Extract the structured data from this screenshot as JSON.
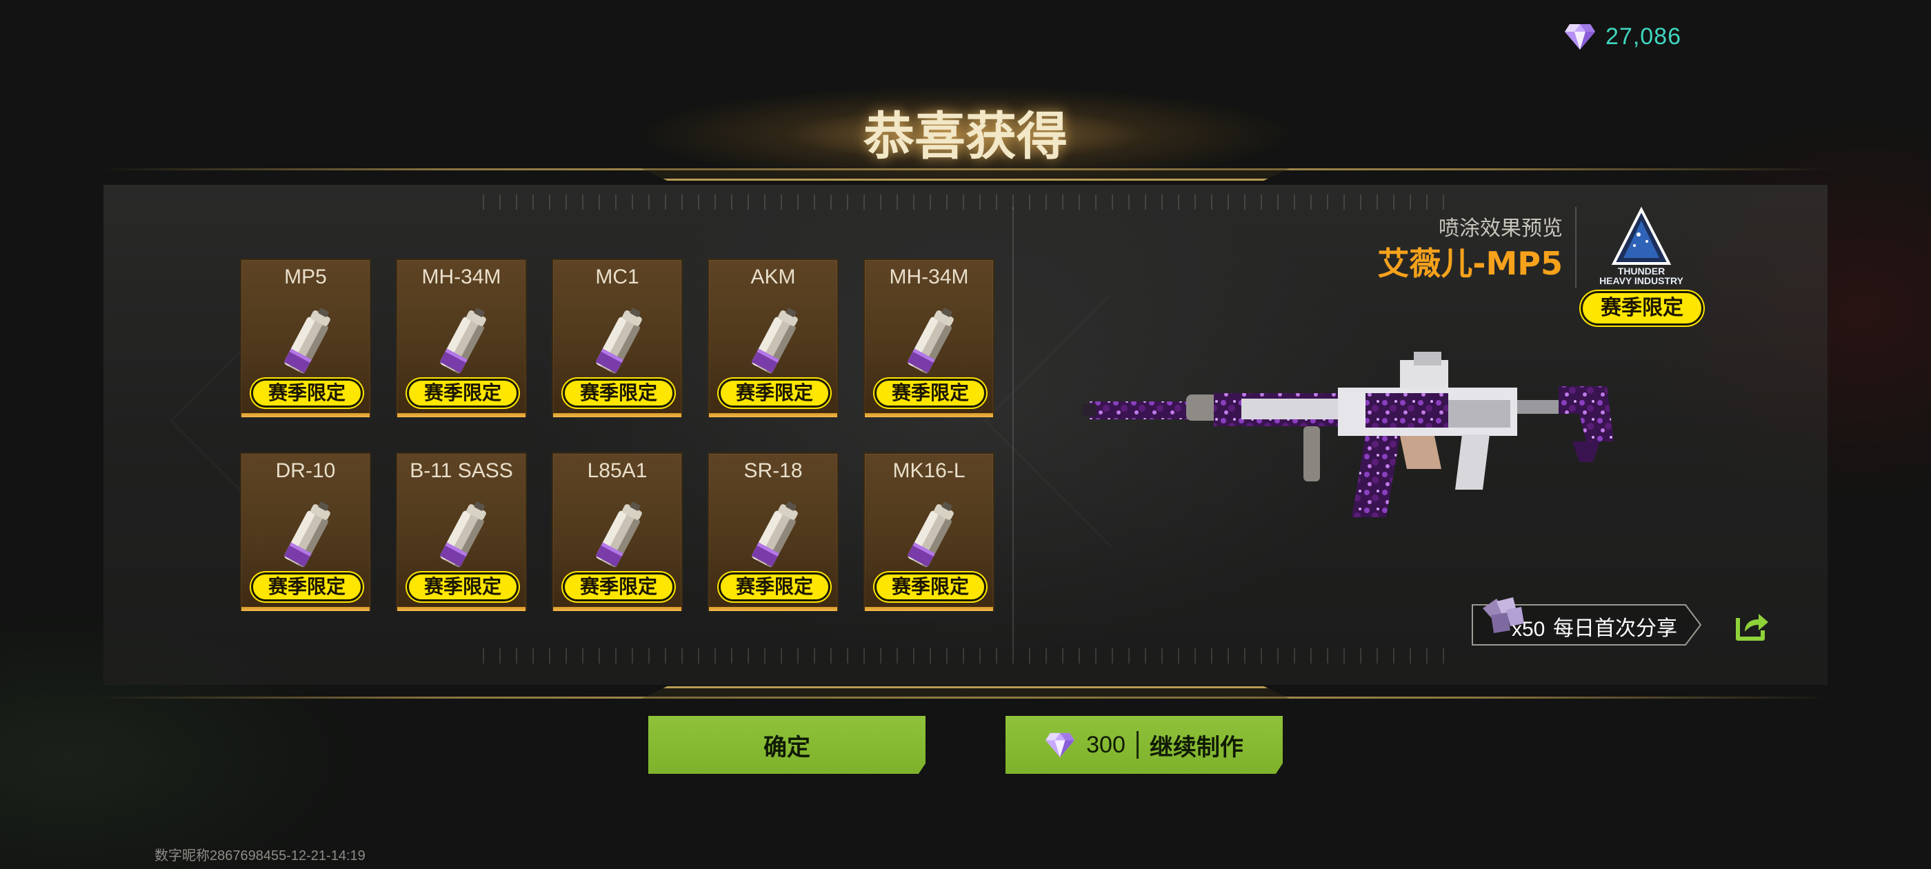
{
  "currency": {
    "icon": "diamond-icon",
    "amount": "27,086"
  },
  "title": "恭喜获得",
  "items": [
    {
      "name": "MP5",
      "badge": "赛季限定",
      "icon": "spray-can-icon"
    },
    {
      "name": "MH-34M",
      "badge": "赛季限定",
      "icon": "spray-can-icon"
    },
    {
      "name": "MC1",
      "badge": "赛季限定",
      "icon": "spray-can-icon"
    },
    {
      "name": "AKM",
      "badge": "赛季限定",
      "icon": "spray-can-icon"
    },
    {
      "name": "MH-34M",
      "badge": "赛季限定",
      "icon": "spray-can-icon"
    },
    {
      "name": "DR-10",
      "badge": "赛季限定",
      "icon": "spray-can-icon"
    },
    {
      "name": "B-11 SASS",
      "badge": "赛季限定",
      "icon": "spray-can-icon"
    },
    {
      "name": "L85A1",
      "badge": "赛季限定",
      "icon": "spray-can-icon"
    },
    {
      "name": "SR-18",
      "badge": "赛季限定",
      "icon": "spray-can-icon"
    },
    {
      "name": "MK16-L",
      "badge": "赛季限定",
      "icon": "spray-can-icon"
    }
  ],
  "preview": {
    "label": "喷涂效果预览",
    "skin_name": "艾薇儿-MP5",
    "brand_line1": "THUNDER",
    "brand_line2": "HEAVY INDUSTRY",
    "badge": "赛季限定"
  },
  "share": {
    "quantity": "x50",
    "label": "每日首次分享",
    "icon": "share-icon"
  },
  "buttons": {
    "confirm": "确定",
    "continue_cost": "300",
    "continue_label": "继续制作"
  },
  "footer": "数字昵称2867698455-12-21-14:19",
  "colors": {
    "accent_green": "#8fc23a",
    "badge_yellow": "#ffe600",
    "skin_orange": "#f6a21c",
    "currency_teal": "#3fd6c0",
    "card_brown": "#5e4424"
  }
}
